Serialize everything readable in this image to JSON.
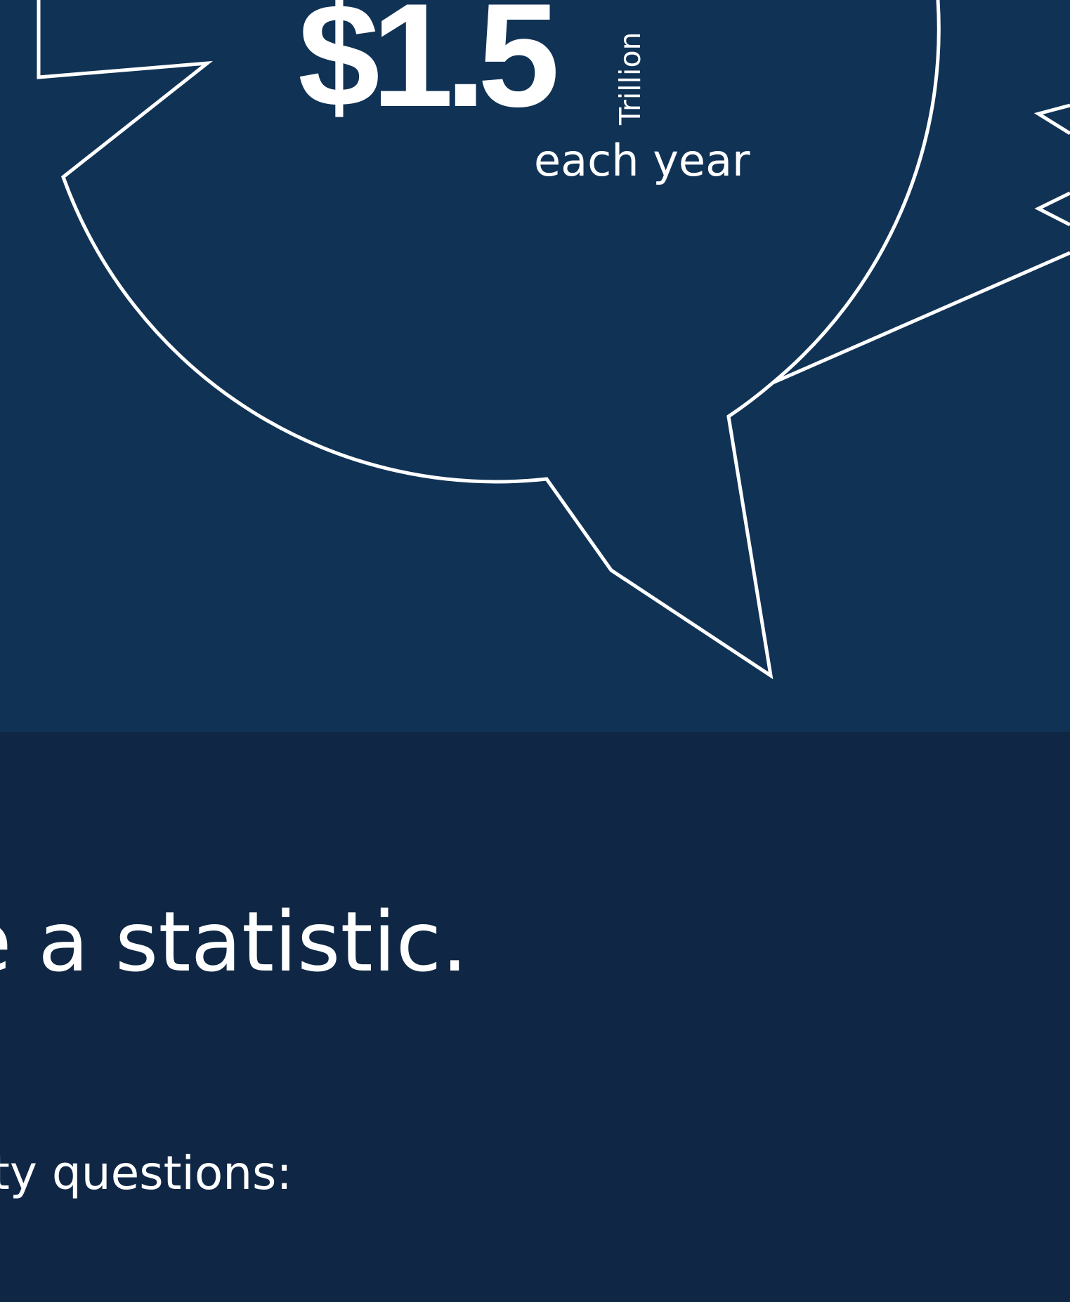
{
  "stat": {
    "value": "$1.5",
    "unit": "Trillion",
    "period": "each year"
  },
  "content": {
    "heading_fragment": "e a statistic.",
    "subtext_fragment": "ty questions:"
  },
  "colors": {
    "hero_background": "#103255",
    "page_background": "#0f2744",
    "text": "#ffffff",
    "outline": "#ffffff"
  },
  "icons": {
    "speech_bubble": "speech-bubble-outline-icon"
  }
}
